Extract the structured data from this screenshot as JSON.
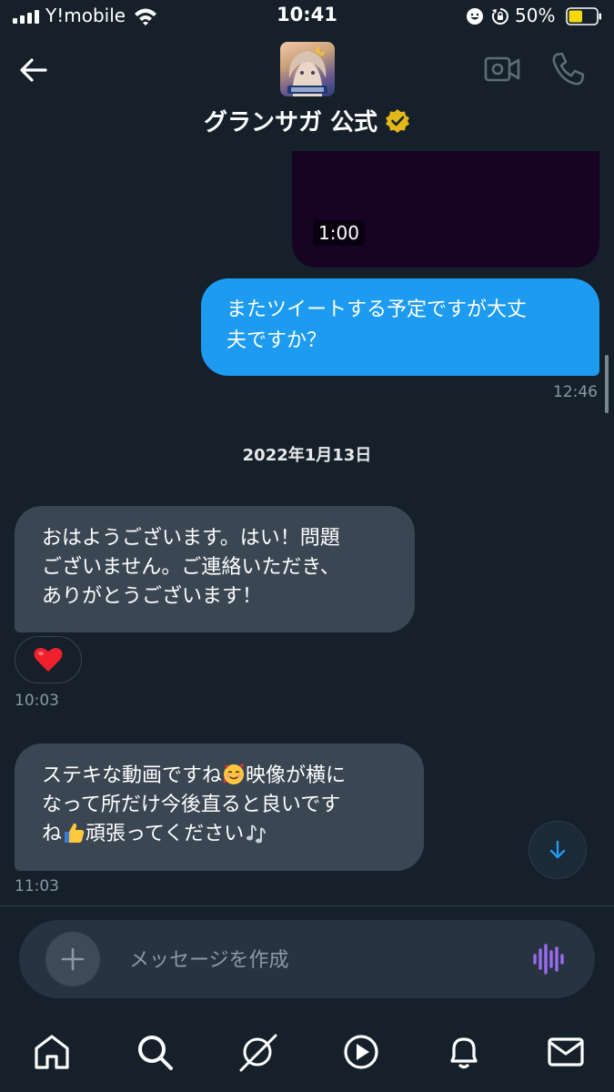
{
  "status_bar": {
    "carrier": "Y!mobile",
    "time": "10:41",
    "battery_percent": "50%",
    "battery_level": 0.5,
    "icons": [
      "signal-icon",
      "wifi-icon",
      "face-icon",
      "rotation-lock-icon",
      "battery-icon"
    ]
  },
  "header": {
    "title": "グランサガ 公式",
    "back_icon": "back-arrow-icon",
    "verified_icon": "verified-badge-icon",
    "video_call_icon": "video-camera-icon",
    "phone_call_icon": "phone-icon"
  },
  "messages": [
    {
      "type": "video",
      "direction": "outgoing",
      "duration": "1:00"
    },
    {
      "type": "text",
      "direction": "outgoing",
      "lines": [
        "またツイートする予定ですが大丈",
        "夫ですか？"
      ],
      "time": "12:46"
    },
    {
      "type": "date",
      "label": "2022年1月13日"
    },
    {
      "type": "text",
      "direction": "incoming",
      "lines": [
        "おはようございます。はい！問題",
        "ございません。ご連絡いただき、",
        "ありがとうございます！"
      ],
      "reaction": "heart-emoji",
      "time": "10:03"
    },
    {
      "type": "text",
      "direction": "incoming",
      "line1_a": "ステキな動画ですね",
      "line1_emoji": "smiling-face-with-hearts-emoji",
      "line1_b": "映像が横に",
      "line2": "なって所だけ今後直ると良いです",
      "line3_a": "ね",
      "line3_emoji": "thumbs-up-emoji",
      "line3_b": "頑張ってください",
      "line3_emoji2": "musical-notes-emoji",
      "time": "11:03"
    }
  ],
  "composer": {
    "placeholder": "メッセージを作成",
    "add_icon": "plus-icon",
    "voice_icon": "voice-wave-icon"
  },
  "scroll_down_icon": "arrow-down-icon",
  "bottom_nav": [
    "home-icon",
    "search-icon",
    "spaces-icon",
    "video-play-icon",
    "bell-icon",
    "mail-icon"
  ],
  "colors": {
    "background": "#15202b",
    "outgoing_bubble": "#1d9bf0",
    "incoming_bubble": "#3a4652",
    "accent": "#1d9bf0",
    "voice_icon": "#9b6cf0"
  }
}
